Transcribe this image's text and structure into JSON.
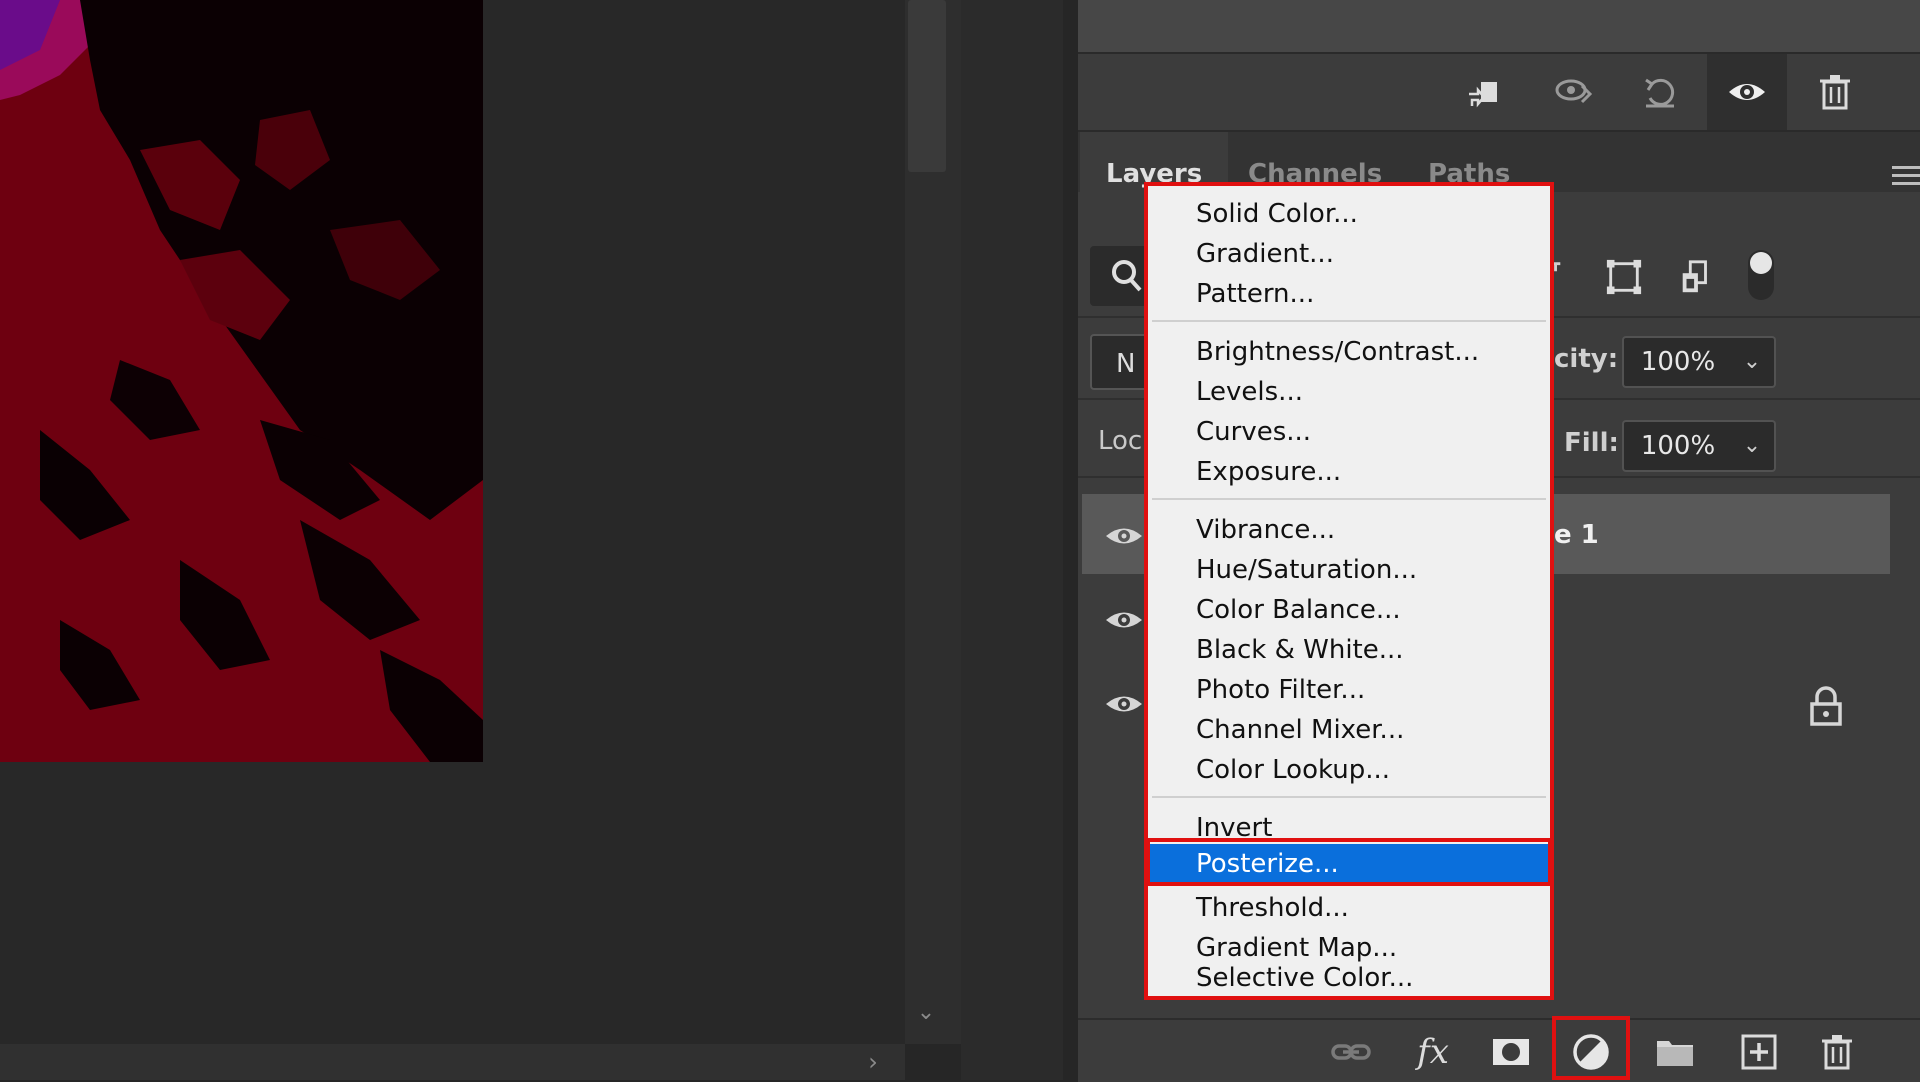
{
  "panel": {
    "tabs": [
      "Layers",
      "Channels",
      "Paths"
    ],
    "blend_mode_partial": "N",
    "lock_label_partial": "Loc",
    "opacity_label_partial": "city:",
    "opacity_value": "100%",
    "fill_label": "Fill:",
    "fill_value": "100%",
    "selected_layer_name_partial": "e 1"
  },
  "props_toolbar_icons": [
    "clip-to-layer-icon",
    "view-previous-icon",
    "reset-icon",
    "visibility-eye-icon",
    "delete-icon"
  ],
  "filter_icons": [
    "type-filter-icon",
    "shape-filter-icon",
    "smart-object-filter-icon"
  ],
  "bottom_bar_icons": [
    "link-layers-icon",
    "fx-icon",
    "add-mask-icon",
    "adjustment-layer-icon",
    "new-group-icon",
    "new-layer-icon",
    "delete-layer-icon"
  ],
  "bottom_bar": {
    "fx_label": "fx"
  },
  "menu": {
    "groups": [
      [
        "Solid Color...",
        "Gradient...",
        "Pattern..."
      ],
      [
        "Brightness/Contrast...",
        "Levels...",
        "Curves...",
        "Exposure..."
      ],
      [
        "Vibrance...",
        "Hue/Saturation...",
        "Color Balance...",
        "Black & White...",
        "Photo Filter...",
        "Channel Mixer...",
        "Color Lookup..."
      ],
      [
        "Invert",
        "Posterize...",
        "Threshold...",
        "Gradient Map...",
        "Selective Color..."
      ]
    ],
    "highlighted": "Posterize..."
  },
  "colors": {
    "accent_highlight": "#0a6fdc",
    "annotation_red": "#e01010",
    "panel_bg": "#3c3c3c",
    "canvas_bg": "#282828"
  }
}
